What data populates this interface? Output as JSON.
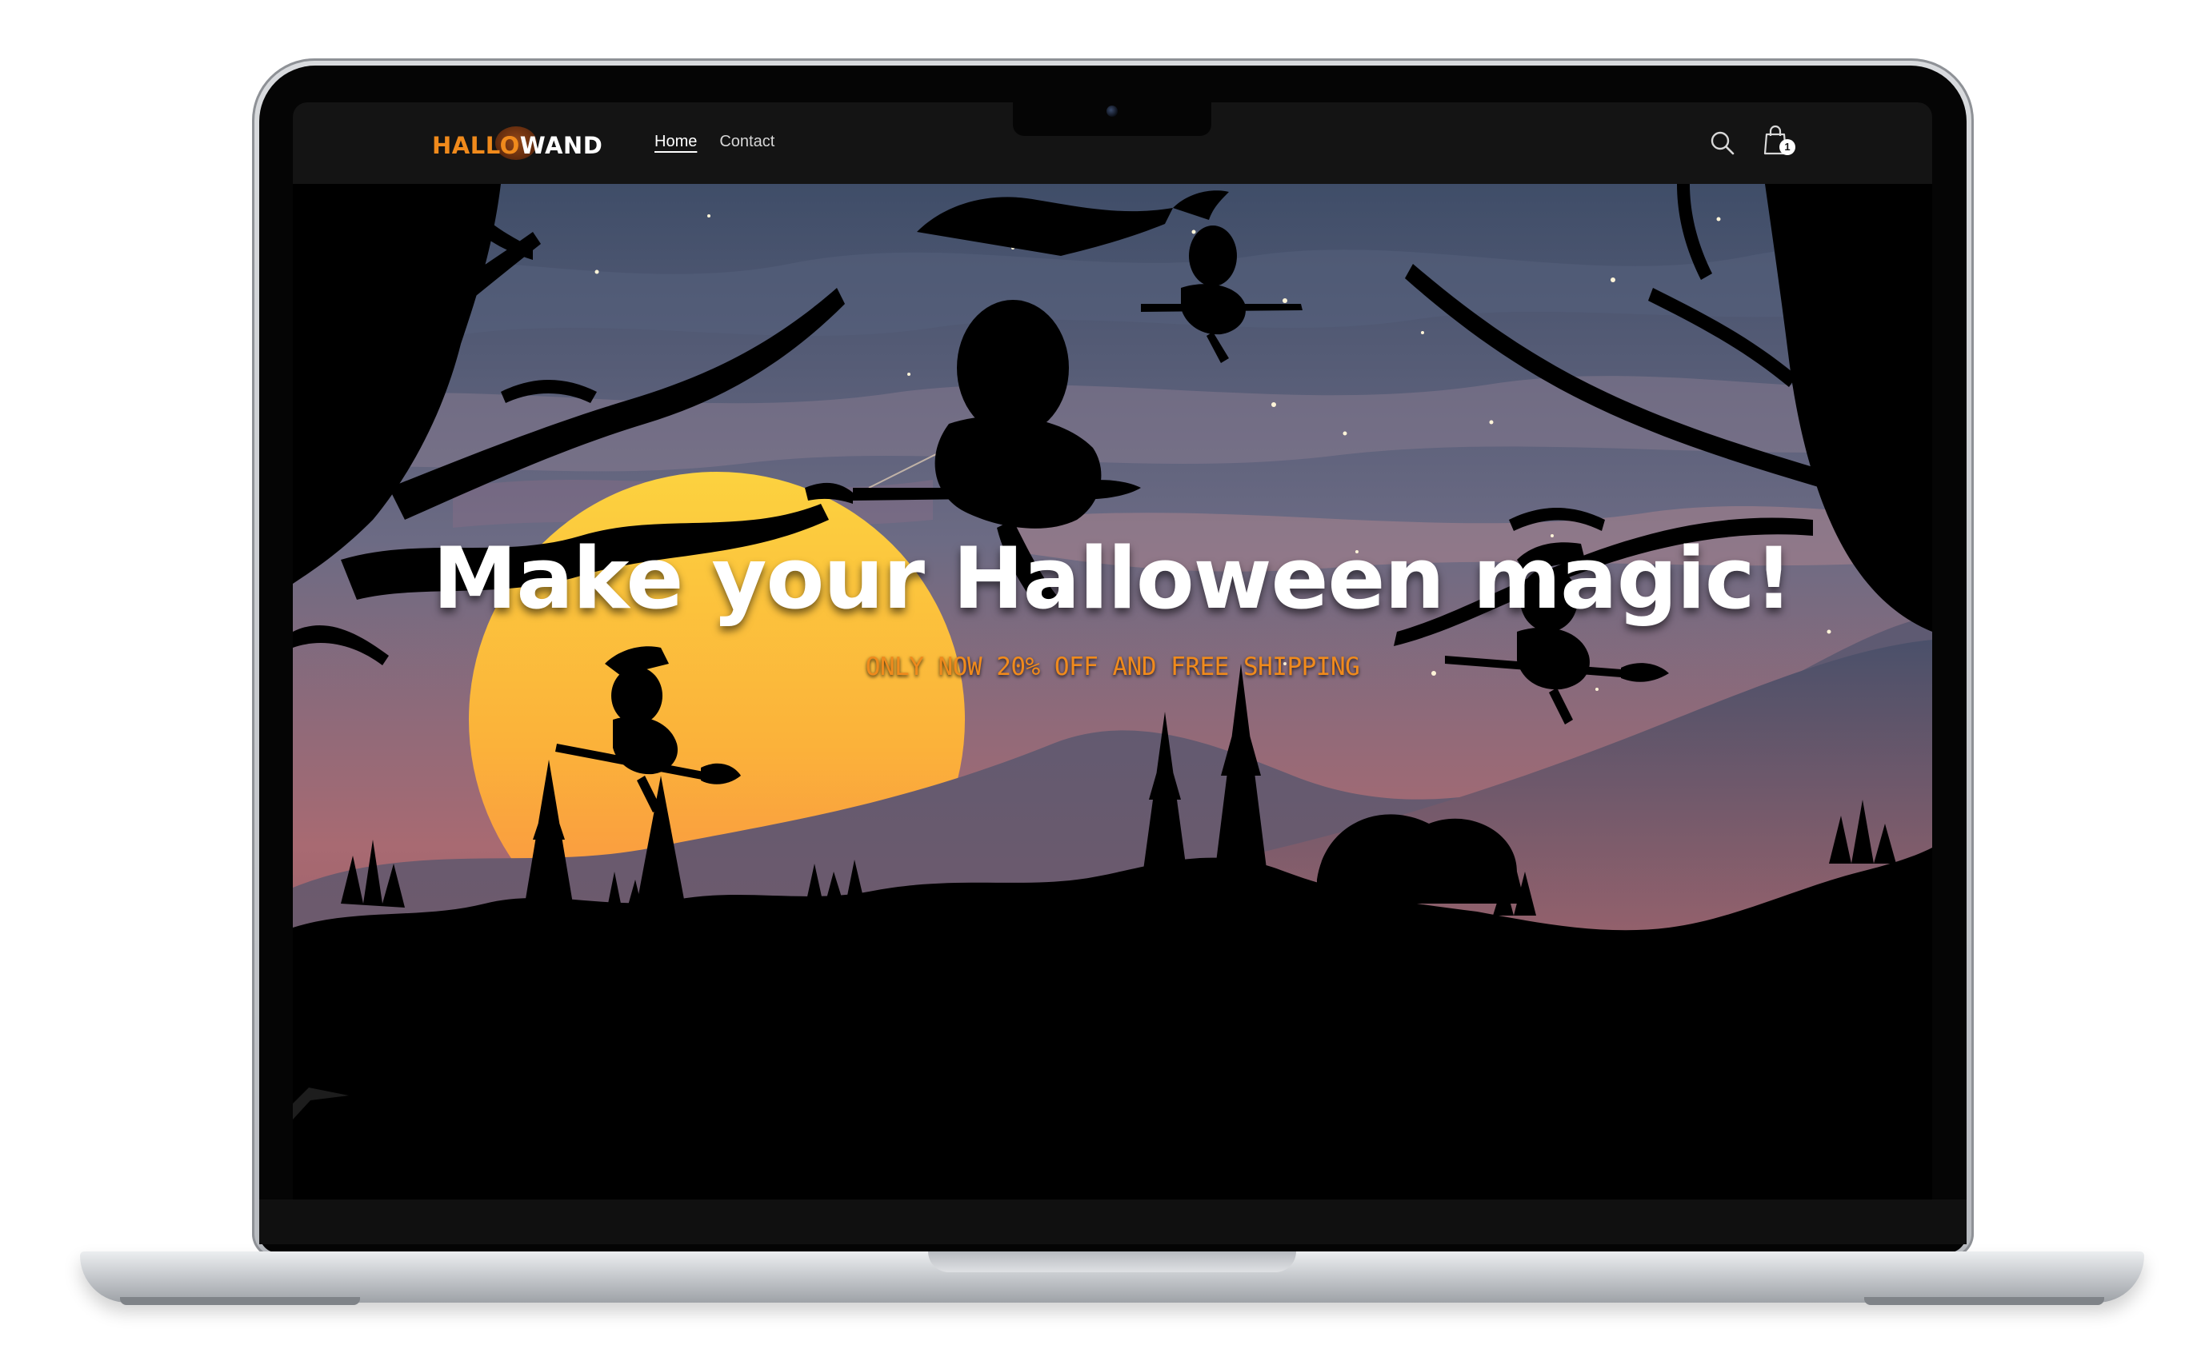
{
  "site": {
    "logo_primary": "HALLO",
    "logo_secondary": "WAND"
  },
  "nav": {
    "items": [
      {
        "label": "Home",
        "active": true
      },
      {
        "label": "Contact",
        "active": false
      }
    ]
  },
  "header_icons": {
    "search": "search-icon",
    "cart": "shopping-bag-icon",
    "cart_count": "1"
  },
  "hero": {
    "title": "Make your Halloween magic!",
    "subtitle": "ONLY NOW 20% OFF AND FREE SHIPPING"
  },
  "colors": {
    "accent": "#f08a1c",
    "header_bg": "#141414",
    "sky_top": "#3f4d68",
    "sky_bottom": "#a86a72",
    "moon": "#fbc63a"
  }
}
